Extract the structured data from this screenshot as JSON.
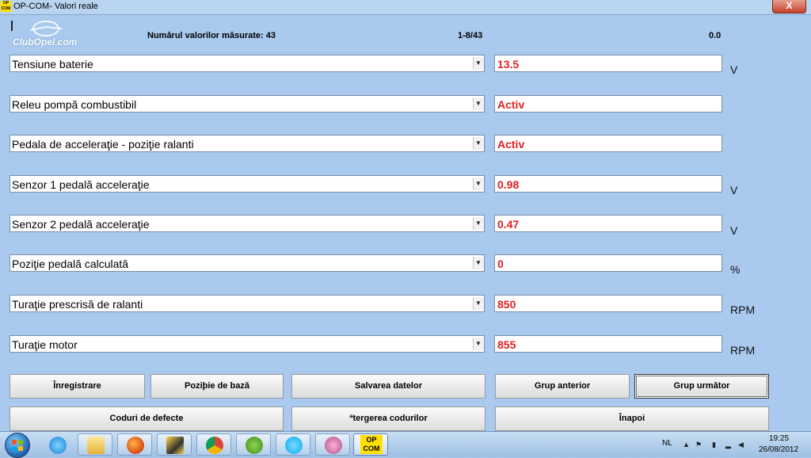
{
  "window": {
    "app_icon": "OP\nCOM",
    "title": "OP-COM- Valori reale",
    "close_label": "X"
  },
  "logo": {
    "text": "ClubOpel.com"
  },
  "header": {
    "count_label": "Numărul valorilor măsurate: 43",
    "range_label": "1-8/43",
    "time_value": "0.0"
  },
  "rows": [
    {
      "label": "Tensiune baterie",
      "value": "13.5",
      "unit": "V"
    },
    {
      "label": "Releu pompă combustibil",
      "value": "Activ",
      "unit": ""
    },
    {
      "label": "Pedala de acceleraţie - poziţie ralanti",
      "value": "Activ",
      "unit": ""
    },
    {
      "label": "Senzor 1 pedală acceleraţie",
      "value": "0.98",
      "unit": "V"
    },
    {
      "label": "Senzor 2 pedală acceleraţie",
      "value": "0.47",
      "unit": "V"
    },
    {
      "label": "Poziţie pedală calculată",
      "value": "0",
      "unit": "%"
    },
    {
      "label": "Turaţie prescrisă de ralanti",
      "value": "850",
      "unit": "RPM"
    },
    {
      "label": "Turaţie motor",
      "value": "855",
      "unit": "RPM"
    }
  ],
  "buttons": {
    "record": "Înregistrare",
    "base_position": "Poziþie de bază",
    "save_data": "Salvarea datelor",
    "prev_group": "Grup anterior",
    "next_group": "Grup următor",
    "fault_codes": "Coduri de defecte",
    "clear_codes": "ªtergerea codurilor",
    "back": "Înapoi"
  },
  "taskbar": {
    "opcom_label": "OP\nCOM",
    "language": "NL",
    "time": "19:25",
    "date": "26/08/2012"
  },
  "colors": {
    "window_bg": "#a9c9ee",
    "value_text": "#e02020"
  }
}
